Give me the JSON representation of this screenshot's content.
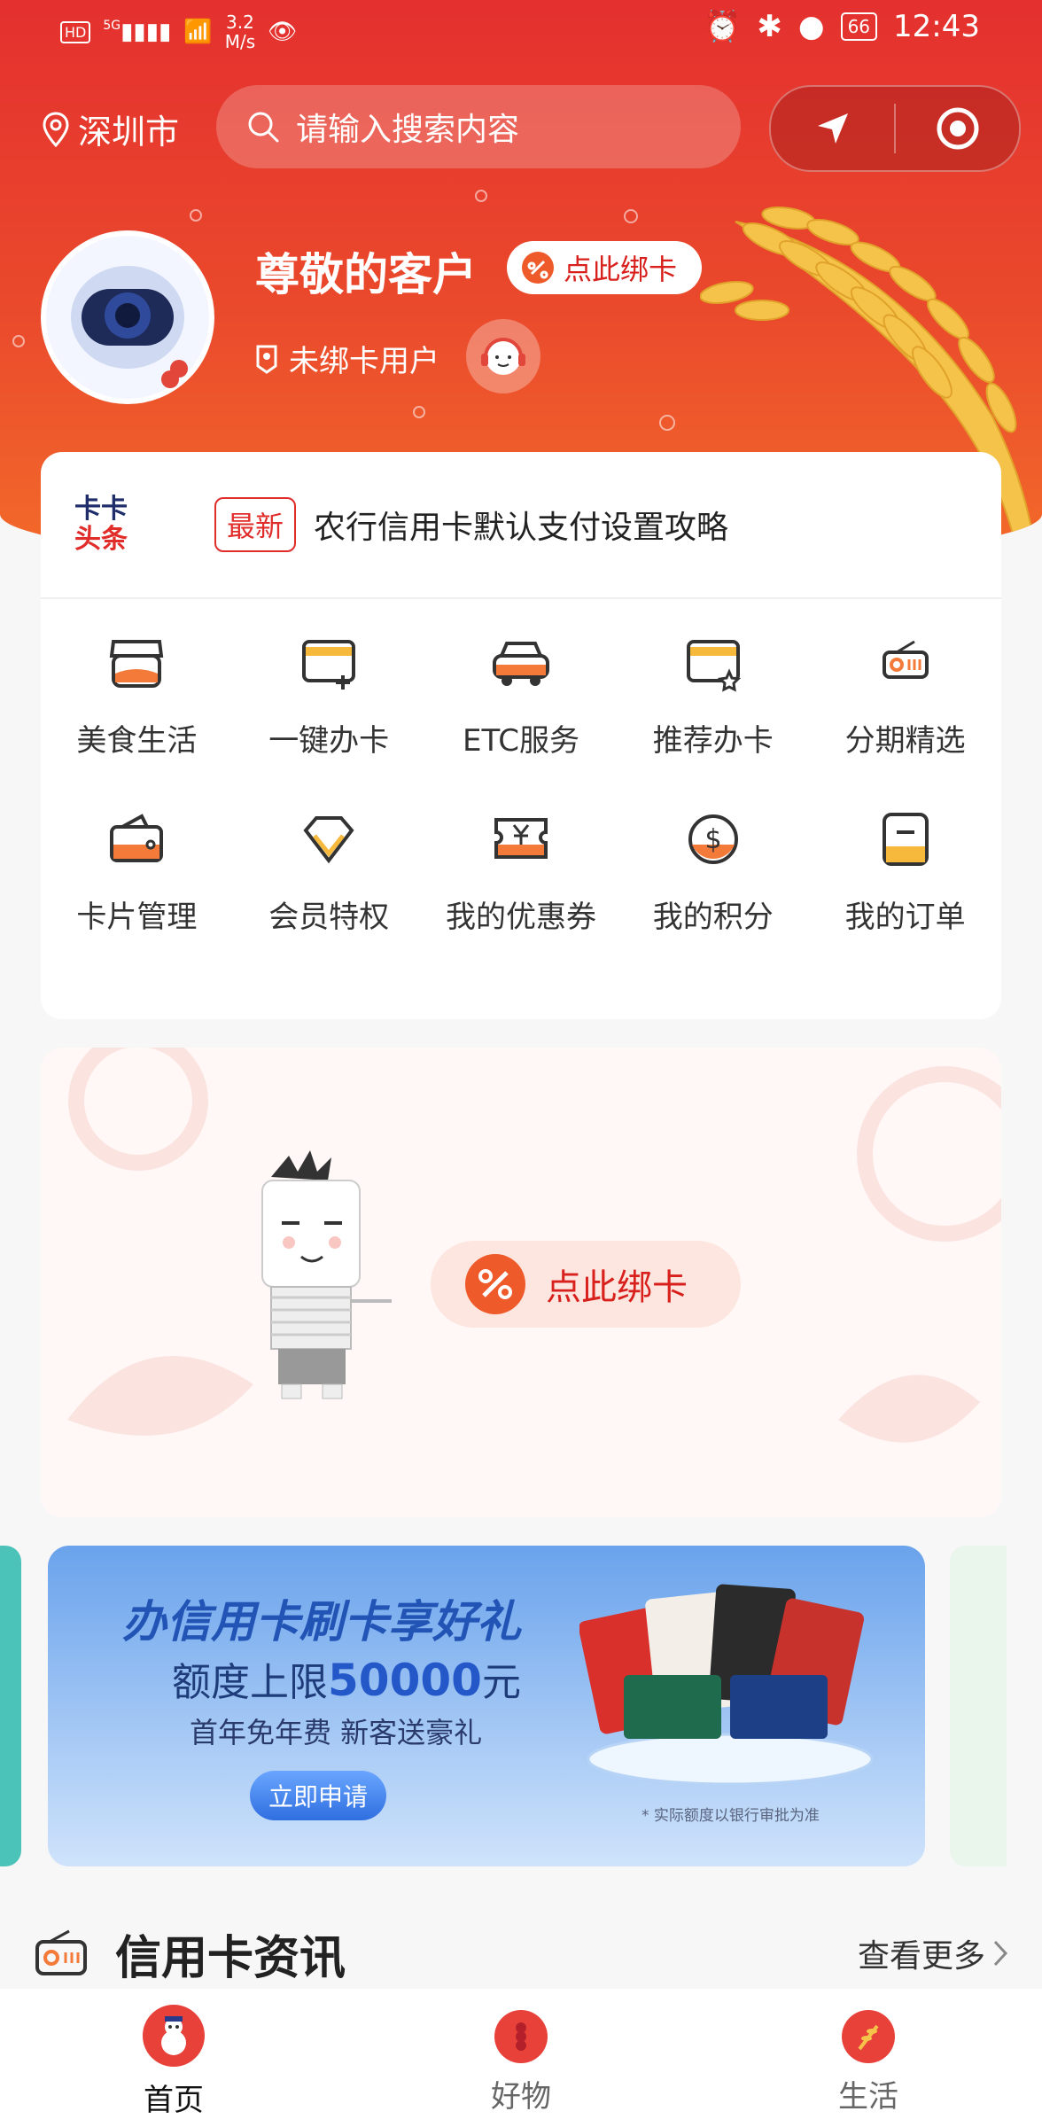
{
  "statusbar": {
    "left_hd": "HD",
    "left_5g": "5G",
    "speed_value": "3.2",
    "speed_unit": "M/s",
    "battery": "66",
    "time": "12:43"
  },
  "header": {
    "city": "深圳市",
    "search_placeholder": "请输入搜索内容"
  },
  "user": {
    "greeting": "尊敬的客户",
    "bind_pill": "点此绑卡",
    "status": "未绑卡用户"
  },
  "news": {
    "brand_line1": "卡卡",
    "brand_line2": "头条",
    "tag": "最新",
    "headline": "农行信用卡默认支付设置攻略"
  },
  "grid": [
    {
      "label": "美食生活",
      "icon": "food-life-icon"
    },
    {
      "label": "一键办卡",
      "icon": "apply-card-icon"
    },
    {
      "label": "ETC服务",
      "icon": "car-icon"
    },
    {
      "label": "推荐办卡",
      "icon": "recommend-card-icon"
    },
    {
      "label": "分期精选",
      "icon": "radio-icon"
    },
    {
      "label": "卡片管理",
      "icon": "wallet-icon"
    },
    {
      "label": "会员特权",
      "icon": "diamond-icon"
    },
    {
      "label": "我的优惠券",
      "icon": "coupon-icon"
    },
    {
      "label": "我的积分",
      "icon": "points-icon"
    },
    {
      "label": "我的订单",
      "icon": "order-icon"
    }
  ],
  "bind_card": {
    "button": "点此绑卡"
  },
  "banner": {
    "title": "办信用卡刷卡享好礼",
    "limit_prefix": "额度上限",
    "limit_value": "50000",
    "limit_suffix": "元",
    "sub": "首年免年费 新客送豪礼",
    "cta": "立即申请",
    "note": "* 实际额度以银行审批为准"
  },
  "info": {
    "title": "信用卡资讯",
    "more": "查看更多"
  },
  "tabs": [
    {
      "label": "首页",
      "active": true
    },
    {
      "label": "好物",
      "active": false
    },
    {
      "label": "生活",
      "active": false
    }
  ],
  "colors": {
    "brand_red": "#e4302f",
    "accent_blue": "#2458c9"
  }
}
